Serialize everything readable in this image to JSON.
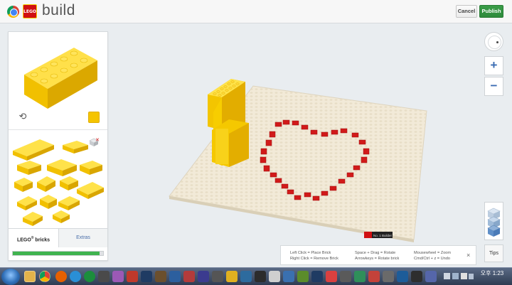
{
  "app": {
    "logo_text": "LEGO",
    "title": "build"
  },
  "header": {
    "cancel_label": "Cancel",
    "publish_label": "Publish"
  },
  "brick_panel": {
    "selected_color": "#f5c400",
    "tabs": [
      {
        "label": "LEGO",
        "sup": "®",
        "suffix": " bricks",
        "active": true
      },
      {
        "label": "Extras",
        "active": false
      }
    ],
    "progress_percent": 96
  },
  "scene": {
    "baseplate_color": "#f2ead8",
    "brick_yellow": "#f7cd00",
    "brick_red": "#d11a1a",
    "plate_badge_text": "No. 1 Builder"
  },
  "controls": {
    "zoom_in_label": "+",
    "zoom_out_label": "−",
    "tips_label": "Tips"
  },
  "help": {
    "col1": [
      "Left Click = Place Brick",
      "Right Click = Remove Brick"
    ],
    "col2": [
      "Space + Drag = Rotate",
      "Arrowkeys = Rotate brick"
    ],
    "col3": [
      "Mousewheel = Zoom",
      "Cmd/Ctrl + z = Undo"
    ],
    "close_label": "×"
  },
  "taskbar": {
    "ampm": "오후",
    "time": "1:23"
  }
}
